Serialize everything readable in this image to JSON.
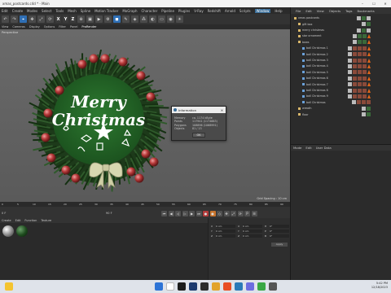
{
  "window": {
    "title": "xmas_postcards.c4d * - Main",
    "minimize": "–",
    "maximize": "☐",
    "close": "✕"
  },
  "menubar": [
    "Edit",
    "Create",
    "Modes",
    "Select",
    "Tools",
    "Mesh",
    "Spline",
    "Motion Tracker",
    "MoGraph",
    "Character",
    "Pipeline",
    "Plugins",
    "V-Ray",
    "Redshift",
    "Arnold",
    "Scripts",
    "Window",
    "Help"
  ],
  "menubar_highlight": "Window",
  "toolbar": {
    "xyz": [
      "X",
      "Y",
      "Z"
    ]
  },
  "viewport_menu": {
    "items": [
      "View",
      "Cameras",
      "Display",
      "Options",
      "Filter",
      "Panel",
      "ProRender"
    ],
    "active": "ProRender"
  },
  "viewport": {
    "camera": "Perspective",
    "grid_spacing": "Grid Spacing : 10 cm"
  },
  "scene": {
    "title_line1": "Merry",
    "title_line2": "Christmas"
  },
  "info_dialog": {
    "title": "Information",
    "rows": [
      {
        "key": "Memory",
        "value": "ca. 1174 kByte"
      },
      {
        "key": "Points",
        "value": "117941 (1174663)"
      },
      {
        "key": "Polygons",
        "value": "108896 (1068991)"
      },
      {
        "key": "Objects",
        "value": "81 / 13"
      }
    ],
    "ok_label": "OK"
  },
  "timeline": {
    "ruler_ticks": [
      "0",
      "5",
      "10",
      "15",
      "20",
      "25",
      "30",
      "35",
      "40",
      "45",
      "50",
      "55",
      "60",
      "65",
      "70",
      "75",
      "80",
      "85",
      "90"
    ],
    "current_frame": "0 F",
    "start_frame": "0 F",
    "end_frame": "90 F"
  },
  "material_panel": {
    "menu": [
      "Create",
      "Edit",
      "Function",
      "Texture"
    ]
  },
  "coordinates": {
    "rows": [
      {
        "a": "X",
        "b": "0 cm",
        "c": "X",
        "d": "0 cm",
        "e": "H",
        "f": "0°"
      },
      {
        "a": "Y",
        "b": "0 cm",
        "c": "Y",
        "d": "0 cm",
        "e": "P",
        "f": "0°"
      },
      {
        "a": "Z",
        "b": "0 cm",
        "c": "Z",
        "d": "0 cm",
        "e": "B",
        "f": "0°"
      }
    ],
    "mode": "World",
    "scale": "Scale",
    "apply_label": "Apply"
  },
  "object_manager": {
    "menu": [
      "File",
      "Edit",
      "View",
      "Objects",
      "Tags",
      "Bookmarks"
    ],
    "objects": [
      {
        "name": "xmas postcards",
        "level": 0,
        "tags": [
          "w",
          "g",
          "w"
        ]
      },
      {
        "name": "gift box",
        "level": 1,
        "tags": [
          "w",
          "g"
        ]
      },
      {
        "name": "merry christmas",
        "level": 1,
        "tags": [
          "w",
          "g",
          "w"
        ]
      },
      {
        "name": "star ornament",
        "level": 1,
        "tags": [
          "w",
          "g",
          "g",
          "o"
        ]
      },
      {
        "name": "bows",
        "level": 1,
        "tags": [
          "w",
          "g",
          "g",
          "o"
        ]
      },
      {
        "name": "ball Christmas 1",
        "level": 2,
        "tags": [
          "w",
          "r",
          "r",
          "r",
          "o"
        ]
      },
      {
        "name": "ball Christmas 2",
        "level": 2,
        "tags": [
          "w",
          "r",
          "r",
          "r",
          "o"
        ]
      },
      {
        "name": "ball Christmas 3",
        "level": 2,
        "tags": [
          "w",
          "r",
          "r",
          "r",
          "o"
        ]
      },
      {
        "name": "ball Christmas 4",
        "level": 2,
        "tags": [
          "w",
          "r",
          "r",
          "r",
          "o"
        ]
      },
      {
        "name": "ball Christmas 5",
        "level": 2,
        "tags": [
          "w",
          "r",
          "r",
          "r",
          "o"
        ]
      },
      {
        "name": "ball Christmas 6",
        "level": 2,
        "tags": [
          "w",
          "r",
          "r",
          "r",
          "o"
        ]
      },
      {
        "name": "ball Christmas 7",
        "level": 2,
        "tags": [
          "w",
          "r",
          "r",
          "r",
          "o"
        ]
      },
      {
        "name": "ball Christmas 8",
        "level": 2,
        "tags": [
          "w",
          "r",
          "r",
          "r",
          "o"
        ]
      },
      {
        "name": "ball Christmas 9",
        "level": 2,
        "tags": [
          "w",
          "r",
          "r",
          "r",
          "o"
        ]
      },
      {
        "name": "ball Christmas",
        "level": 2,
        "tags": [
          "w",
          "r",
          "r",
          "r"
        ]
      },
      {
        "name": "wreath",
        "level": 1,
        "tags": [
          "w",
          "g"
        ]
      },
      {
        "name": "floor",
        "level": 1,
        "tags": [
          "w",
          "g"
        ]
      }
    ]
  },
  "attribute_manager": {
    "menu": [
      "Mode",
      "Edit",
      "User Data"
    ]
  },
  "taskbar": {
    "time": "5:42 PM",
    "date": "12/18/2023"
  },
  "colors": {
    "accent": "#3a6e99",
    "wreath_green": "#1e5a22",
    "ornament_red": "#b83a3a"
  }
}
